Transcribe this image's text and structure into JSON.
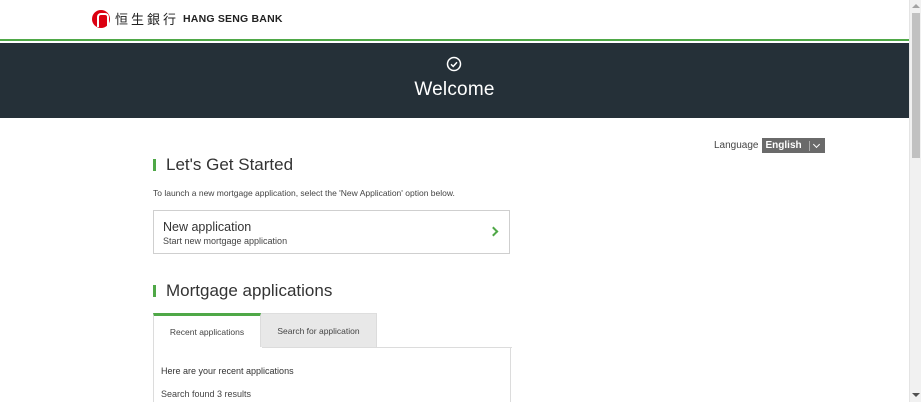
{
  "header": {
    "logo_chinese": "恒生銀行",
    "logo_english": "HANG SENG BANK"
  },
  "banner": {
    "title": "Welcome",
    "icon": "check-circle-icon"
  },
  "language": {
    "label": "Language",
    "selected": "English"
  },
  "get_started": {
    "title": "Let's Get Started",
    "description": "To launch a new mortgage application, select the 'New Application' option below.",
    "new_app_title": "New application",
    "new_app_subtitle": "Start new mortgage application"
  },
  "mortgage": {
    "title": "Mortgage applications",
    "tabs": [
      {
        "label": "Recent applications",
        "active": true
      },
      {
        "label": "Search for application",
        "active": false
      }
    ],
    "panel_heading": "Here are your recent applications",
    "result_count": "Search found 3 results"
  },
  "colors": {
    "accent": "#4fa847",
    "banner_bg": "#253038",
    "brand_red": "#db0011"
  }
}
